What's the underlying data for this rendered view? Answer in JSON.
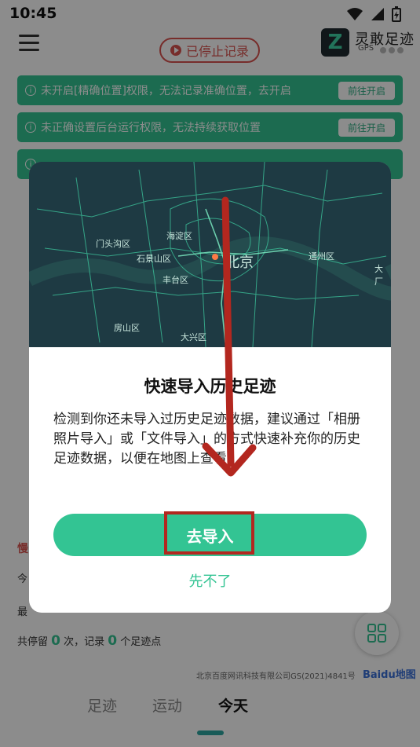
{
  "status_bar": {
    "time": "10:45"
  },
  "header": {
    "record_label": "已停止记录",
    "brand_name": "灵敢足迹",
    "brand_sub": "GPS"
  },
  "warnings": [
    {
      "text": "未开启[精确位置]权限，无法记录准确位置，去开启",
      "action": "前往开启"
    },
    {
      "text": "未正确设置后台运行权限，无法持续获取位置",
      "action": "前往开启"
    },
    {
      "text": "",
      "action": ""
    }
  ],
  "background_stats": {
    "slow_label": "慢",
    "today_prefix": "今",
    "max_prefix": "最",
    "stay_prefix": "共停留",
    "stay_count": "0",
    "stay_middle": "次，记录",
    "point_count": "0",
    "stay_suffix": "个足迹点"
  },
  "map": {
    "labels": {
      "mentougou": "门头沟区",
      "haidian": "海淀区",
      "shijingshan": "石景山区",
      "beijing": "北京",
      "tongzhou": "通州区",
      "daxing_partial": "大厂",
      "fengtai": "丰台区",
      "fangshan": "房山区",
      "daxing": "大兴区"
    },
    "copyright": "北京百度网讯科技有限公司GS(2021)4841号",
    "logo": "Baidu地图"
  },
  "dialog": {
    "title": "快速导入历史足迹",
    "body": "检测到你还未导入过历史足迹数据，建议通过「相册照片导入」或「文件导入」的方式快速补充你的历史足迹数据，以便在地图上查看。",
    "primary": "去导入",
    "secondary": "先不了"
  },
  "tabs": [
    "足迹",
    "运动",
    "今天"
  ],
  "active_tab": "今天",
  "colors": {
    "accent": "#33c493",
    "record_red": "#d9534f",
    "annotation_red": "#b3271f"
  }
}
